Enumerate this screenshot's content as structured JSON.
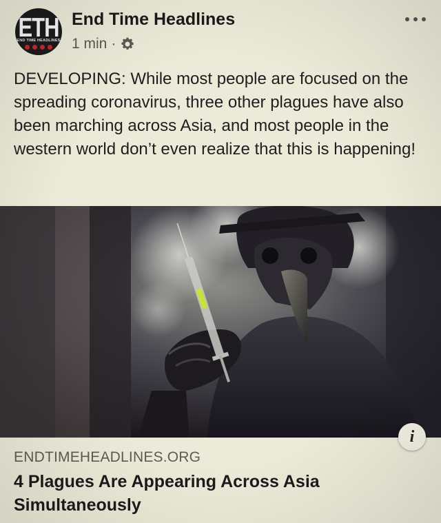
{
  "post": {
    "page_name": "End Time Headlines",
    "timestamp": "1 min",
    "separator": "·",
    "privacy_icon": "gear-icon",
    "more_icon": "more-dots-icon",
    "avatar": {
      "monogram": "ETH",
      "subtitle": "END TIME HEADLINES",
      "accent_color": "#c8262b"
    },
    "text": "DEVELOPING: While most people are focused on the spreading coronavirus, three other plagues have also been marching across Asia, and most people in the western world don’t even realize that this is happening!"
  },
  "link_preview": {
    "image_subject": "plague-doctor-with-syringe-image",
    "info_icon_glyph": "i",
    "domain": "ENDTIMEHEADLINES.ORG",
    "title": "4 Plagues Are Appearing Across Asia Simultaneously"
  }
}
